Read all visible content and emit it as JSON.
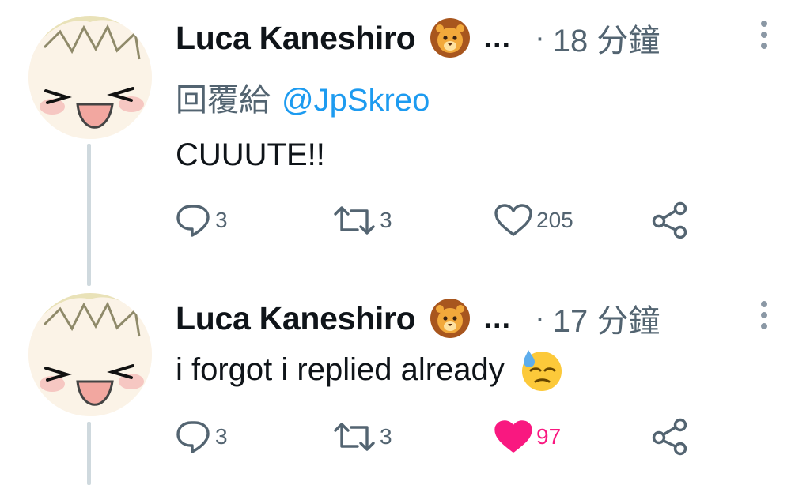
{
  "tweets": [
    {
      "author": "Luca Kaneshiro",
      "ellipsis": "...",
      "dot": "·",
      "time": "18 分鐘",
      "reply_prefix": "回覆給",
      "reply_handle": "@JpSkreo",
      "text": "CUUUTE!!",
      "replies": "3",
      "retweets": "3",
      "likes": "205",
      "liked": false
    },
    {
      "author": "Luca Kaneshiro",
      "ellipsis": "...",
      "dot": "·",
      "time": "17 分鐘",
      "text": "i forgot i replied already",
      "replies": "3",
      "retweets": "3",
      "likes": "97",
      "liked": true
    }
  ],
  "colors": {
    "accent_link": "#1d9bf0",
    "like_pink": "#f91880",
    "muted": "#536471",
    "thread_line": "#cfd9de"
  },
  "icons": [
    "lion-emoji-icon",
    "sweat-emoji-icon",
    "reply-icon",
    "retweet-icon",
    "heart-icon",
    "share-icon",
    "more-icon"
  ]
}
